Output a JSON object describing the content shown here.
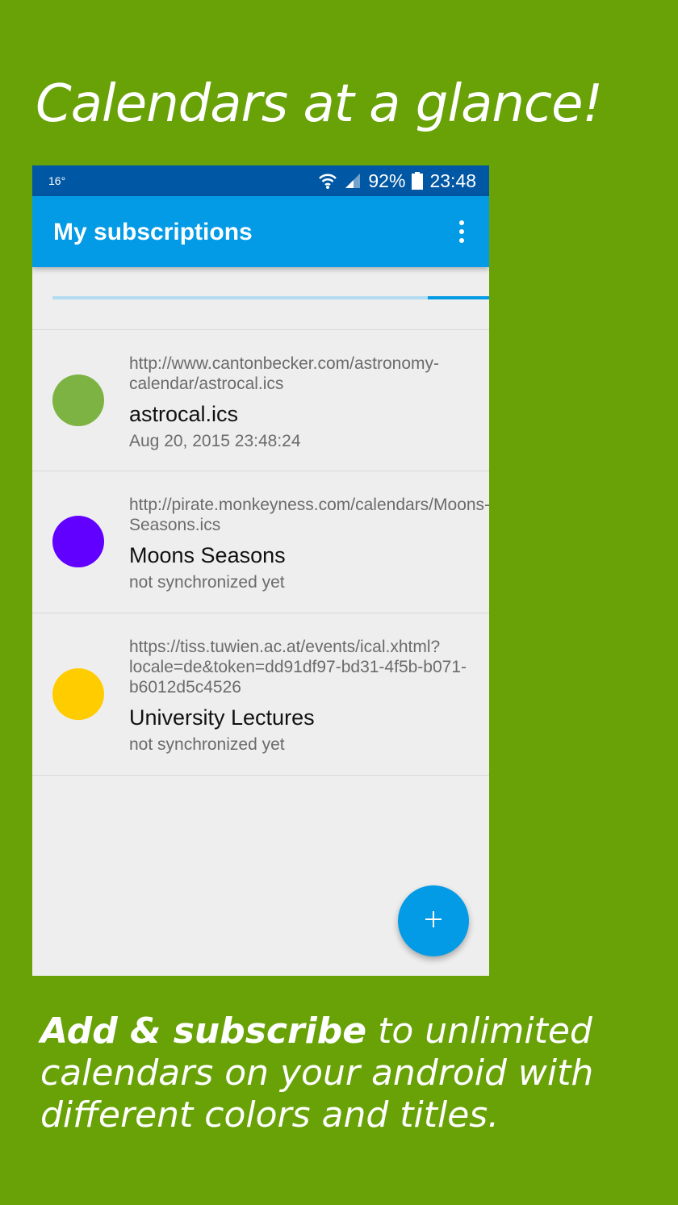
{
  "headline": "Calendars at a glance!",
  "status_bar": {
    "temperature": "16°",
    "battery": "92%",
    "time": "23:48",
    "icons": [
      "wifi-icon",
      "signal-icon",
      "battery-icon"
    ]
  },
  "app_bar": {
    "title": "My subscriptions",
    "menu_icon": "more-vert-icon"
  },
  "sync_progress": 0.14,
  "subscriptions": [
    {
      "url": "http://www.cantonbecker.com/astronomy-calendar/astrocal.ics",
      "title": "astrocal.ics",
      "status": "Aug 20, 2015 23:48:24",
      "color": "#7cb342"
    },
    {
      "url": "http://pirate.monkeyness.com/calendars/Moons-Seasons.ics",
      "title": "Moons Seasons",
      "status": "not synchronized yet",
      "color": "#6200ff"
    },
    {
      "url": "https://tiss.tuwien.ac.at/events/ical.xhtml?locale=de&token=dd91df97-bd31-4f5b-b071-b6012d5c4526",
      "title": "University Lectures",
      "status": "not synchronized yet",
      "color": "#ffcc00"
    }
  ],
  "fab_icon": "add-icon",
  "caption": {
    "bold": "Add & subscribe",
    "rest": " to unlimited calendars on your android with different colors and titles."
  },
  "colors": {
    "background": "#68a207",
    "status_bar": "#0057a3",
    "accent": "#039be5"
  }
}
